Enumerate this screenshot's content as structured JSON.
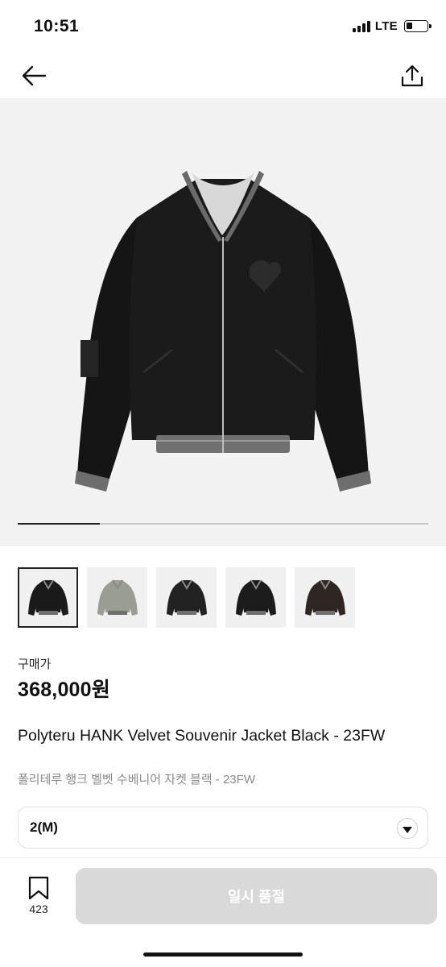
{
  "status_bar": {
    "time": "10:51",
    "network": "LTE",
    "battery_level": 0.3
  },
  "nav": {
    "back_icon": "arrow-left-icon",
    "share_icon": "share-icon"
  },
  "gallery": {
    "current_index": 1,
    "total_images": 5,
    "thumbnails": [
      {
        "name": "black-jacket-front",
        "color": "#1a1a1a"
      },
      {
        "name": "olive-jacket-reverse",
        "color": "#9a9d92"
      },
      {
        "name": "black-jacket-alt",
        "color": "#222222"
      },
      {
        "name": "black-jacket-back",
        "color": "#1c1c1c"
      },
      {
        "name": "brown-jacket",
        "color": "#2e2623"
      }
    ]
  },
  "product": {
    "price_label": "구매가",
    "price": "368,000원",
    "name_en": "Polyteru HANK Velvet Souvenir Jacket Black - 23FW",
    "name_ko": "폴리테루 행크 벨벳 수베니어 자켓 블랙 - 23FW"
  },
  "size_select": {
    "value": "2(M)"
  },
  "bottom_bar": {
    "bookmark_count": "423",
    "action_label": "일시 품절"
  },
  "colors": {
    "soldout_button": "#d9d9d9",
    "hero_background": "#f2f2f2"
  }
}
